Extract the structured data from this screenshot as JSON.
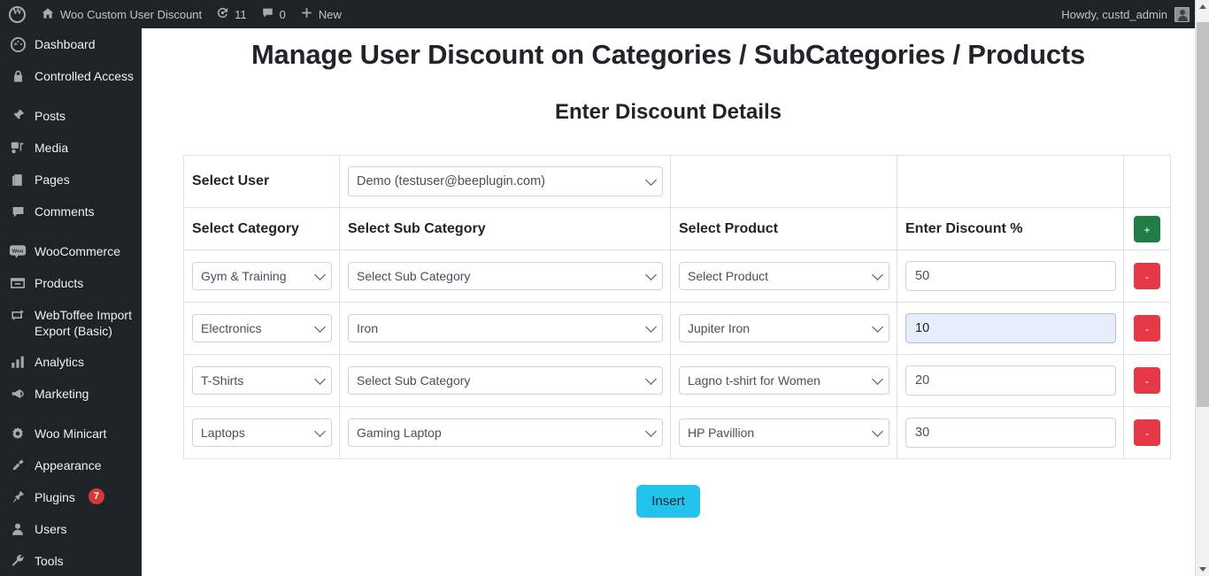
{
  "adminbar": {
    "logo_icon": "wordpress-logo-icon",
    "site_icon": "home-icon",
    "site_name": "Woo Custom User Discount",
    "updates_icon": "updates-icon",
    "updates_count": "11",
    "comments_icon": "comment-bubble-icon",
    "comments_count": "0",
    "new_icon": "plus-icon",
    "new_label": "New",
    "howdy": "Howdy, custd_admin",
    "avatar_icon": "user-avatar-icon"
  },
  "sidebar": {
    "items": [
      {
        "label": "Dashboard",
        "icon": "dashboard-gauge-icon",
        "badge": ""
      },
      {
        "label": "Controlled Access",
        "icon": "lock-icon",
        "badge": ""
      },
      {
        "label": "Posts",
        "icon": "pushpin-icon",
        "badge": ""
      },
      {
        "label": "Media",
        "icon": "media-icon",
        "badge": ""
      },
      {
        "label": "Pages",
        "icon": "pages-icon",
        "badge": ""
      },
      {
        "label": "Comments",
        "icon": "comment-bubble-icon",
        "badge": ""
      },
      {
        "label": "WooCommerce",
        "icon": "woo-icon",
        "badge": ""
      },
      {
        "label": "Products",
        "icon": "products-box-icon",
        "badge": ""
      },
      {
        "label": "WebToffee Import Export (Basic)",
        "icon": "import-export-icon",
        "badge": ""
      },
      {
        "label": "Analytics",
        "icon": "bar-chart-icon",
        "badge": ""
      },
      {
        "label": "Marketing",
        "icon": "megaphone-icon",
        "badge": ""
      },
      {
        "label": "Woo Minicart",
        "icon": "gear-icon",
        "badge": ""
      },
      {
        "label": "Appearance",
        "icon": "paint-brush-icon",
        "badge": ""
      },
      {
        "label": "Plugins",
        "icon": "plug-icon",
        "badge": "7"
      },
      {
        "label": "Users",
        "icon": "user-icon",
        "badge": ""
      },
      {
        "label": "Tools",
        "icon": "wrench-icon",
        "badge": ""
      }
    ]
  },
  "main": {
    "page_title": "Manage User Discount on Categories / SubCategories / Products",
    "sub_title": "Enter Discount Details",
    "user_row": {
      "label": "Select User",
      "select_value": "Demo (testuser@beeplugin.com)"
    },
    "headers": {
      "category": "Select Category",
      "subcategory": "Select Sub Category",
      "product": "Select Product",
      "discount": "Enter Discount %"
    },
    "add_row_button": "+",
    "remove_row_button": "-",
    "rows": [
      {
        "category": "Gym & Training",
        "subcategory": "Select Sub Category",
        "product": "Select Product",
        "discount": "50",
        "discount_highlighted": false
      },
      {
        "category": "Electronics",
        "subcategory": "Iron",
        "product": "Jupiter Iron",
        "discount": "10",
        "discount_highlighted": true
      },
      {
        "category": "T-Shirts",
        "subcategory": "Select Sub Category",
        "product": "Lagno t-shirt for Women",
        "discount": "20",
        "discount_highlighted": false
      },
      {
        "category": "Laptops",
        "subcategory": "Gaming Laptop",
        "product": "HP Pavillion",
        "discount": "30",
        "discount_highlighted": false
      }
    ],
    "insert_button": "Insert"
  },
  "colors": {
    "admin_bar_bg": "#1d2327",
    "sidebar_bg": "#1d2327",
    "add_button_bg": "#1e7e45",
    "remove_button_bg": "#e63946",
    "insert_button_bg": "#22c4ee",
    "plugin_badge_bg": "#d63638",
    "table_border": "#dee2e6",
    "autofill_bg": "#e8edfb"
  },
  "scrollbar": {
    "up_arrow_icon": "scroll-up-arrow-icon",
    "down_arrow_icon": "scroll-down-arrow-icon"
  }
}
